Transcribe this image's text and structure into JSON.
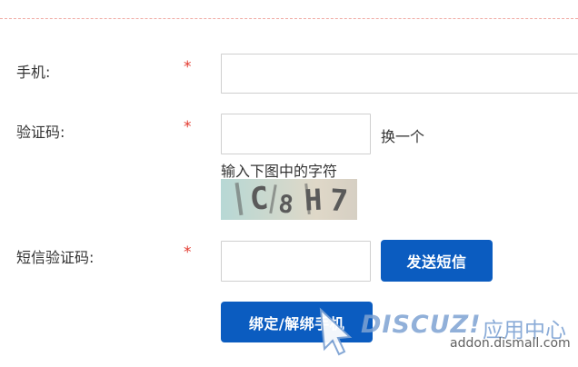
{
  "form": {
    "phone_label": "手机:",
    "captcha_label": "验证码:",
    "sms_code_label": "短信验证码:",
    "required_mark": "*",
    "refresh_captcha": "换一个",
    "captcha_hint": "输入下图中的字符",
    "captcha_text": "C8H7",
    "send_sms_button": "发送短信",
    "bind_unbind_button": "绑定/解绑手机"
  },
  "watermark": {
    "brand": "DISCUZ!",
    "brand_suffix": "应用中心",
    "url": "addon.dismall.com"
  },
  "colors": {
    "primary_button": "#0b5cc0",
    "required": "#e33a2f",
    "divider": "#f0a9a3",
    "watermark": "#7ea3d3"
  }
}
